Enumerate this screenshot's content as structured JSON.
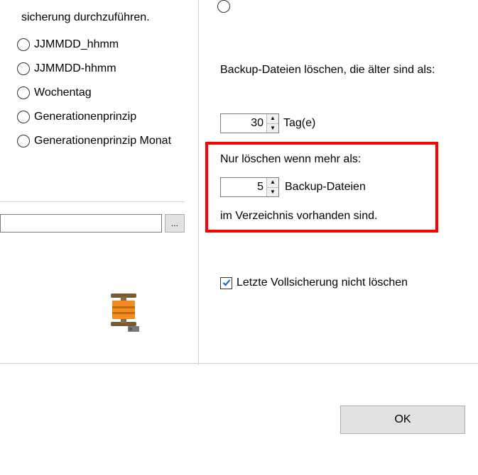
{
  "left": {
    "intro_tail": "sicherung durchzuführen.",
    "radios": [
      "JJMMDD_hhmm",
      "JJMMDD-hhmm",
      "Wochentag",
      "Generationenprinzip",
      "Generationenprinzip Monat"
    ],
    "path_value": "",
    "browse_label": "..."
  },
  "right": {
    "cutoff_label": "",
    "delete_older": "Backup-Dateien löschen, die älter sind als:",
    "days_value": "30",
    "days_unit": "Tag(e)",
    "only_delete": "Nur löschen wenn mehr als:",
    "files_value": "5",
    "files_unit": "Backup-Dateien",
    "in_dir": "im Verzeichnis vorhanden sind.",
    "keep_full": "Letzte Vollsicherung nicht löschen",
    "keep_full_checked": true
  },
  "footer": {
    "ok": "OK"
  }
}
